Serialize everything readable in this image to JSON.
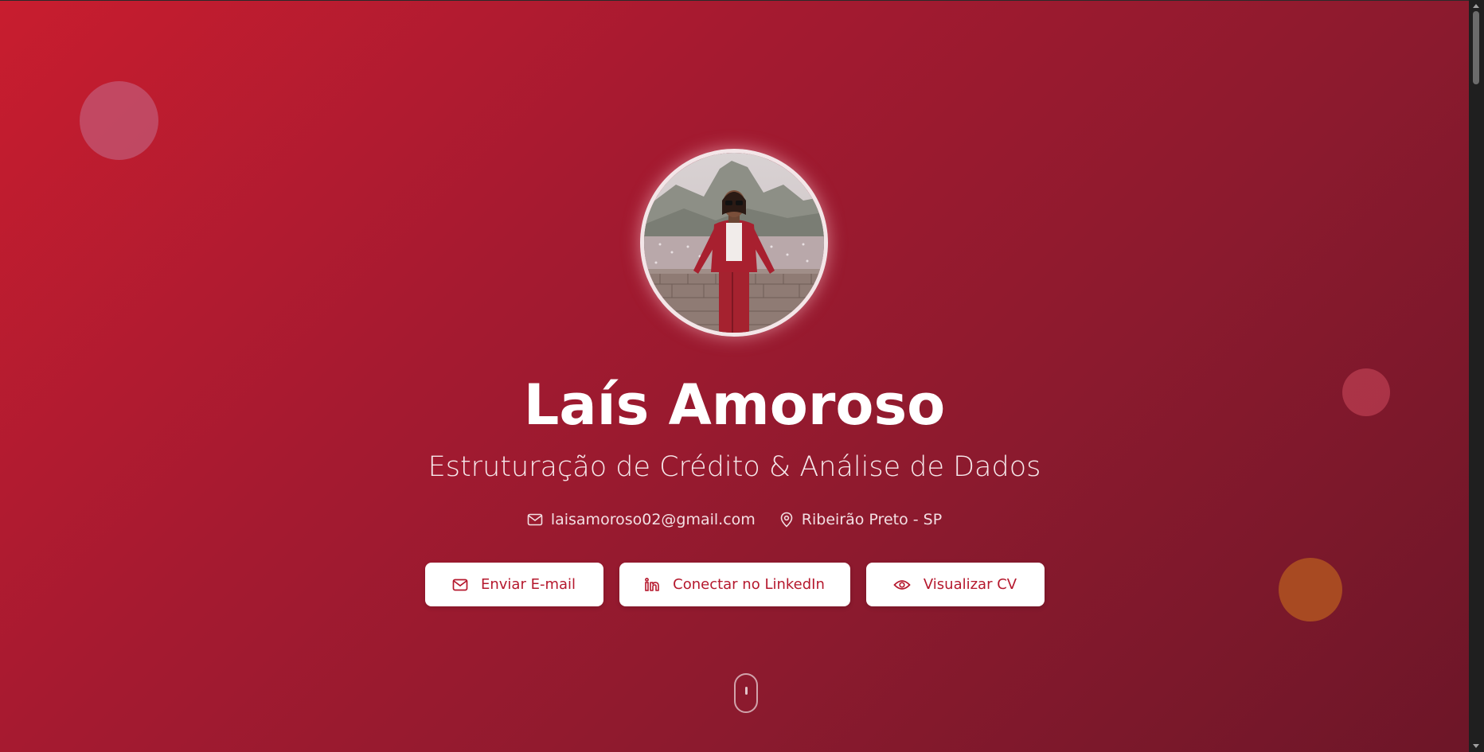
{
  "colors": {
    "gradient_start": "#c81d2f",
    "gradient_end": "#6d1628",
    "button_bg": "#ffffff",
    "button_text": "#b5182d",
    "accent_orange": "#a84a22"
  },
  "hero": {
    "name": "Laís Amoroso",
    "subtitle": "Estruturação de Crédito & Análise de Dados",
    "profile_photo": {
      "icon": "profile-photo"
    }
  },
  "contact": {
    "email": {
      "icon": "mail-icon",
      "text": "laisamoroso02@gmail.com"
    },
    "location": {
      "icon": "map-pin-icon",
      "text": "Ribeirão Preto - SP"
    }
  },
  "buttons": {
    "email": {
      "icon": "mail-icon",
      "label": "Enviar E-mail"
    },
    "linkedin": {
      "icon": "linkedin-icon",
      "label": "Conectar no LinkedIn"
    },
    "cv": {
      "icon": "eye-icon",
      "label": "Visualizar CV"
    }
  },
  "scroll_indicator": {
    "icon": "mouse-scroll-icon"
  }
}
